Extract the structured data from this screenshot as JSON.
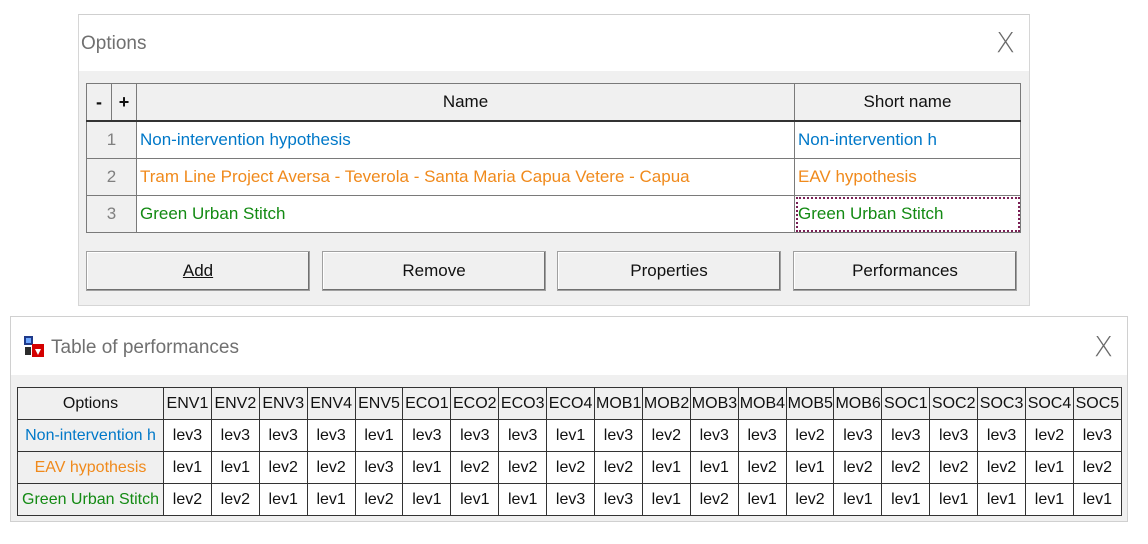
{
  "options_window": {
    "title": "Options",
    "close_glyph": "X",
    "header": {
      "minus": "-",
      "plus": "+",
      "name": "Name",
      "short_name": "Short name"
    },
    "rows": [
      {
        "num": "1",
        "name": "Non-intervention hypothesis",
        "short": "Non-intervention h",
        "color": "#0078c8"
      },
      {
        "num": "2",
        "name": "Tram Line Project Aversa - Teverola - Santa Maria Capua Vetere - Capua",
        "short": "EAV hypothesis",
        "color": "#f08a1c"
      },
      {
        "num": "3",
        "name": "Green Urban Stitch",
        "short": "Green Urban Stitch",
        "color": "#138a13"
      }
    ],
    "buttons": {
      "add": "Add",
      "remove": "Remove",
      "properties": "Properties",
      "performances": "Performances"
    }
  },
  "performance_window": {
    "title": "Table of performances",
    "close_glyph": "X",
    "icon": "app-icon",
    "corner_header": "Options",
    "columns": [
      "ENV1",
      "ENV2",
      "ENV3",
      "ENV4",
      "ENV5",
      "ECO1",
      "ECO2",
      "ECO3",
      "ECO4",
      "MOB1",
      "MOB2",
      "MOB3",
      "MOB4",
      "MOB5",
      "MOB6",
      "SOC1",
      "SOC2",
      "SOC3",
      "SOC4",
      "SOC5"
    ],
    "rows": [
      {
        "label": "Non-intervention h",
        "color": "#0078c8",
        "values": [
          "lev3",
          "lev3",
          "lev3",
          "lev3",
          "lev1",
          "lev3",
          "lev3",
          "lev3",
          "lev1",
          "lev3",
          "lev2",
          "lev3",
          "lev3",
          "lev2",
          "lev3",
          "lev3",
          "lev3",
          "lev3",
          "lev2",
          "lev3"
        ]
      },
      {
        "label": "EAV hypothesis",
        "color": "#f08a1c",
        "values": [
          "lev1",
          "lev1",
          "lev2",
          "lev2",
          "lev3",
          "lev1",
          "lev2",
          "lev2",
          "lev2",
          "lev2",
          "lev1",
          "lev1",
          "lev2",
          "lev1",
          "lev2",
          "lev2",
          "lev2",
          "lev2",
          "lev1",
          "lev2"
        ]
      },
      {
        "label": "Green Urban Stitch",
        "color": "#138a13",
        "values": [
          "lev2",
          "lev2",
          "lev1",
          "lev1",
          "lev2",
          "lev1",
          "lev1",
          "lev1",
          "lev3",
          "lev3",
          "lev1",
          "lev2",
          "lev1",
          "lev2",
          "lev1",
          "lev1",
          "lev1",
          "lev1",
          "lev1",
          "lev1"
        ]
      }
    ]
  }
}
